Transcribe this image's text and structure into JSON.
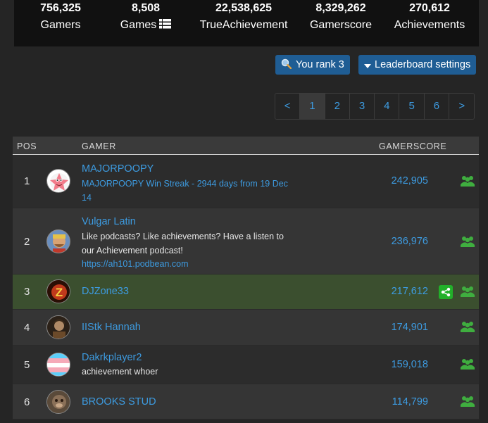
{
  "stats": [
    {
      "value": "756,325",
      "label": "Gamers"
    },
    {
      "value": "8,508",
      "label": "Games"
    },
    {
      "value": "22,538,625",
      "label": "TrueAchievement"
    },
    {
      "value": "8,329,262",
      "label": "Gamerscore"
    },
    {
      "value": "270,612",
      "label": "Achievements"
    }
  ],
  "buttons": {
    "you_rank": "You rank 3",
    "leaderboard_settings": "Leaderboard settings"
  },
  "pagination": {
    "prev": "<",
    "pages": [
      "1",
      "2",
      "3",
      "4",
      "5",
      "6"
    ],
    "next": ">",
    "current": "1"
  },
  "table": {
    "headers": {
      "pos": "POS",
      "gamer": "GAMER",
      "gamerscore": "GAMERSCORE"
    },
    "rows": [
      {
        "pos": "1",
        "name": "MAJORPOOPY",
        "motto": [
          "MAJORPOOPY Win Streak - 2944 days from 19 Dec",
          "14"
        ],
        "motto_is_link": true,
        "link": "",
        "score": "242,905",
        "avatar": "starfish-avatar"
      },
      {
        "pos": "2",
        "name": "Vulgar Latin",
        "motto": [
          "Like podcasts? Like achievements? Have a listen to",
          "our Achievement podcast!"
        ],
        "motto_is_link": false,
        "link": "https://ah101.podbean.com",
        "score": "236,976",
        "avatar": "wrestler-avatar"
      },
      {
        "pos": "3",
        "name": "DJZone33",
        "motto": [],
        "motto_is_link": false,
        "link": "",
        "score": "217,612",
        "avatar": "z-logo-avatar",
        "highlight": true
      },
      {
        "pos": "4",
        "name": "IIStk Hannah",
        "motto": [],
        "motto_is_link": false,
        "link": "",
        "score": "174,901",
        "avatar": "character-avatar"
      },
      {
        "pos": "5",
        "name": "Dakrkplayer2",
        "motto": [
          "achievement whoer"
        ],
        "motto_is_link": false,
        "link": "",
        "score": "159,018",
        "avatar": "flag-avatar"
      },
      {
        "pos": "6",
        "name": "BROOKS STUD",
        "motto": [],
        "motto_is_link": false,
        "link": "",
        "score": "114,799",
        "avatar": "monkey-avatar"
      }
    ]
  },
  "colors": {
    "link": "#3d9be0",
    "button": "#1f5d94",
    "highlight_row": "#3b4f2f",
    "group_icon": "#3fae3f"
  }
}
